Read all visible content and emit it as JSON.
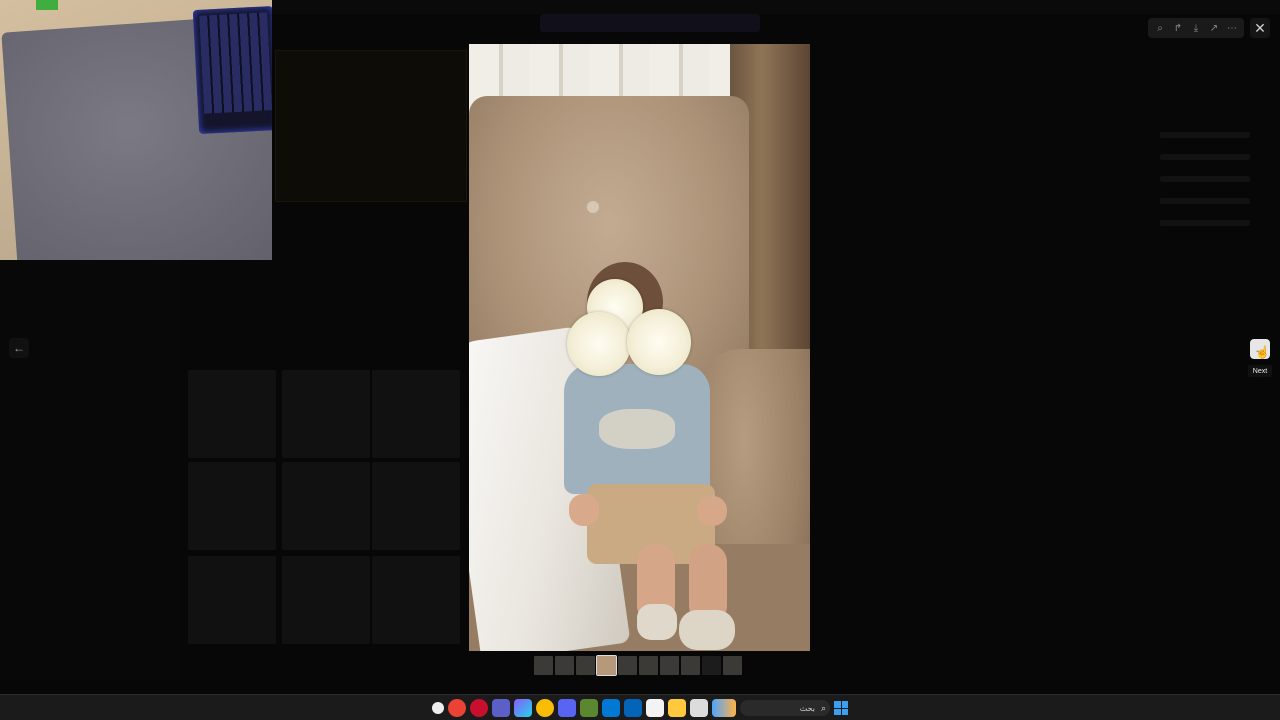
{
  "viewer": {
    "toolbar": {
      "icons": [
        "zoom-icon",
        "share-icon",
        "download-icon",
        "open-external-icon",
        "more-icon"
      ],
      "close_icon": "close-icon"
    },
    "navigation": {
      "prev_icon": "arrow-left-icon",
      "next_icon": "arrow-right-icon",
      "next_tooltip": "Next"
    },
    "thumbnails": {
      "count": 10,
      "active_index": 3
    }
  },
  "taskbar": {
    "search_text": "بحث",
    "icons": [
      "start-icon",
      "chrome-icon",
      "opera-icon",
      "teams-icon",
      "copilot-icon",
      "chrome-icon",
      "discord-icon",
      "minecraft-icon",
      "mail-icon",
      "outlook-icon",
      "store-icon",
      "files-icon",
      "notepad-icon",
      "weather-icon",
      "search-icon",
      "windows-icon"
    ]
  },
  "colors": {
    "accent": "#3aa0f0",
    "background": "#040404"
  }
}
